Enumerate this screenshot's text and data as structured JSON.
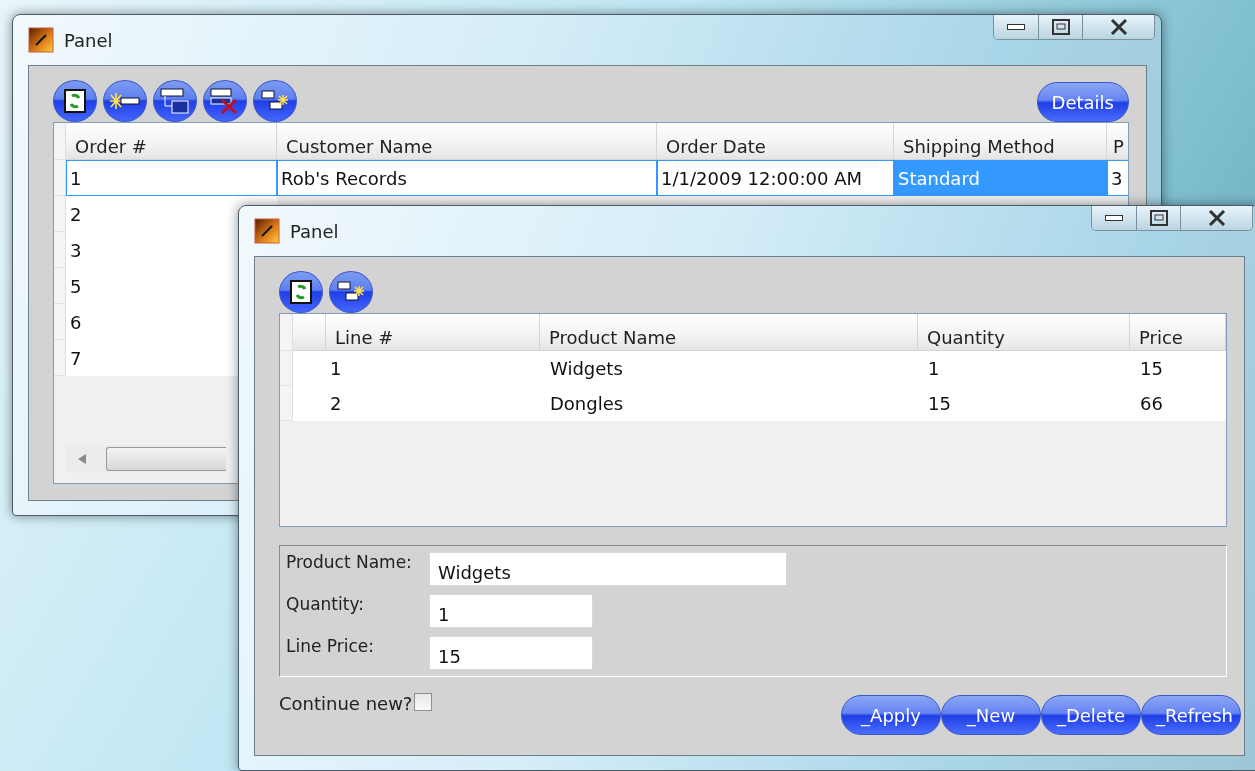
{
  "windows": [
    {
      "title": "Panel",
      "toolbar": [
        {
          "kind": "refresh"
        },
        {
          "kind": "add"
        },
        {
          "kind": "detail"
        },
        {
          "kind": "delete"
        },
        {
          "kind": "copy"
        }
      ],
      "details_button": "Details",
      "grid": {
        "columns": [
          "Order #",
          "Customer Name",
          "Order Date",
          "Shipping Method",
          "P"
        ],
        "rows": [
          {
            "selected": true,
            "cells": [
              {
                "text": "1",
                "selected": false
              },
              {
                "text": "Rob's Records",
                "selected": false
              },
              {
                "text": "1/1/2009 12:00:00 AM",
                "selected": false
              },
              {
                "text": "Standard",
                "selected": true
              },
              {
                "text": "3",
                "selected": false
              }
            ]
          },
          {
            "selected": false,
            "cells": [
              {
                "text": "2",
                "selected": false
              }
            ]
          },
          {
            "selected": false,
            "cells": [
              {
                "text": "3",
                "selected": false
              }
            ]
          },
          {
            "selected": false,
            "cells": [
              {
                "text": "5",
                "selected": false
              }
            ]
          },
          {
            "selected": false,
            "cells": [
              {
                "text": "6",
                "selected": false
              }
            ]
          },
          {
            "selected": false,
            "cells": [
              {
                "text": "7",
                "selected": false
              }
            ]
          }
        ]
      }
    },
    {
      "title": "Panel",
      "toolbar": [
        {
          "kind": "refresh"
        },
        {
          "kind": "copy"
        }
      ],
      "grid": {
        "columns": [
          "Line #",
          "Product Name",
          "Quantity",
          "Price"
        ],
        "rows": [
          [
            "1",
            "Widgets",
            "1",
            "15"
          ],
          [
            "2",
            "Dongles",
            "15",
            "66"
          ]
        ]
      },
      "form": [
        {
          "label": "Product Name:",
          "value": "Widgets"
        },
        {
          "label": "Quantity:",
          "value": "1"
        },
        {
          "label": "Line Price:",
          "value": "15"
        }
      ],
      "continue_new": {
        "label": "Continue new?",
        "checked": false
      },
      "buttons": [
        "_Apply",
        "_New",
        "_Delete",
        "_Refresh"
      ]
    }
  ]
}
